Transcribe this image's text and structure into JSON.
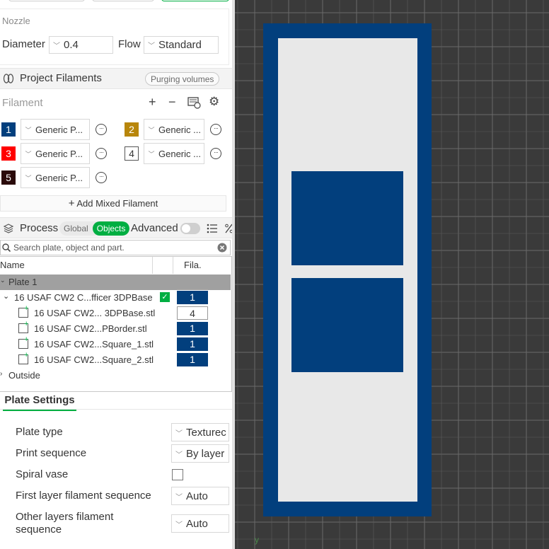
{
  "nozzle": {
    "title": "Nozzle",
    "diameter_label": "Diameter",
    "diameter_value": "0.4",
    "flow_label": "Flow",
    "flow_value": "Standard"
  },
  "project_filaments": {
    "title": "Project Filaments",
    "purging_button": "Purging volumes",
    "filament_label": "Filament",
    "filaments": [
      {
        "num": "1",
        "name": "Generic P...",
        "color": "#023f7d"
      },
      {
        "num": "2",
        "name": "Generic ...",
        "color": "#b8860b"
      },
      {
        "num": "3",
        "name": "Generic P...",
        "color": "#ff0000"
      },
      {
        "num": "4",
        "name": "Generic ...",
        "color": "#ffffff"
      },
      {
        "num": "5",
        "name": "Generic P...",
        "color": "#2a0a0a"
      }
    ],
    "add_mixed": "Add Mixed Filament"
  },
  "process": {
    "title": "Process",
    "global": "Global",
    "objects": "Objects",
    "advanced": "Advanced",
    "search_placeholder": "Search plate, object and part."
  },
  "object_tree": {
    "col_name": "Name",
    "col_fila": "Fila.",
    "plate": "Plate 1",
    "object": {
      "name": "16 USAF CW2 C...fficer 3DPBase",
      "fila": "1"
    },
    "parts": [
      {
        "name": "16 USAF CW2... 3DPBase.stl",
        "fila": "4"
      },
      {
        "name": "16 USAF CW2...PBorder.stl",
        "fila": "1"
      },
      {
        "name": "16 USAF CW2...Square_1.stl",
        "fila": "1"
      },
      {
        "name": "16 USAF CW2...Square_2.stl",
        "fila": "1"
      }
    ],
    "outside": "Outside"
  },
  "plate_settings": {
    "tab": "Plate Settings",
    "plate_type_label": "Plate type",
    "plate_type_value": "Texturec",
    "print_sequence_label": "Print sequence",
    "print_sequence_value": "By layer",
    "spiral_vase_label": "Spiral vase",
    "first_layer_label": "First layer filament sequence",
    "first_layer_value": "Auto",
    "other_layers_label": "Other layers filament sequence",
    "other_layers_value": "Auto"
  },
  "viewport": {
    "axis_label": "y",
    "bg_color": "#3a3a3a",
    "grid_color": "#6a6a6a",
    "model_blue": "#023f7d",
    "model_white": "#e8e8e8"
  }
}
